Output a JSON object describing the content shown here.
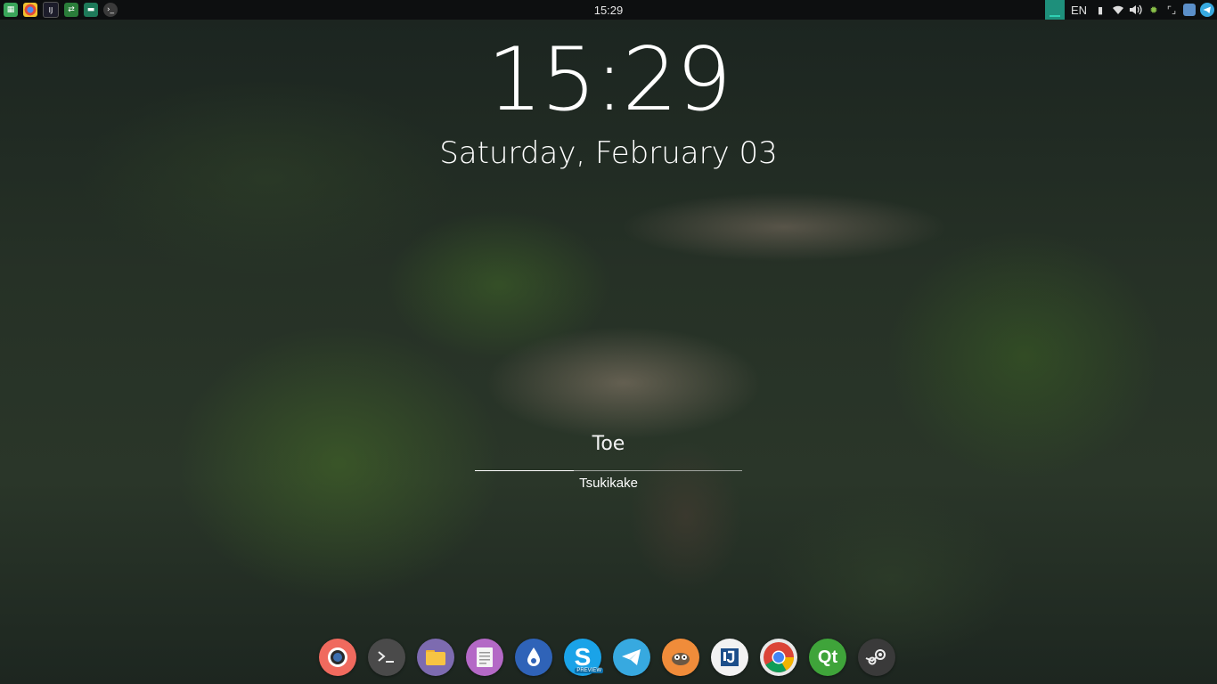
{
  "topbar": {
    "launchers": [
      {
        "icon": "calculator-icon",
        "color": "#3aa55a"
      },
      {
        "icon": "chrome-icon",
        "color": "#444"
      },
      {
        "icon": "jetbrains-icon",
        "color": "#1c1c2a"
      },
      {
        "icon": "network-icon",
        "color": "#2a7d3a"
      },
      {
        "icon": "files-icon",
        "color": "#1e7a5a"
      },
      {
        "icon": "terminal-icon",
        "color": "#3a3a3a"
      }
    ],
    "clock": "15:29",
    "language": "EN",
    "tray": [
      "clipboard-icon",
      "wifi-icon",
      "volume-icon",
      "update-icon",
      "screenshot-icon",
      "notes-icon",
      "telegram-icon"
    ]
  },
  "lockscreen": {
    "time": "15:29",
    "date": "Saturday, February 03",
    "user": "Toe",
    "host": "Tsukikake",
    "password_progress": 0.37
  },
  "dock": {
    "apps": [
      {
        "name": "screenshot-app-icon",
        "color": "#f06a5e"
      },
      {
        "name": "terminal-app-icon",
        "color": "#4a4a4a"
      },
      {
        "name": "files-app-icon",
        "color": "#7d6bb0"
      },
      {
        "name": "text-editor-app-icon",
        "color": "#b469c6"
      },
      {
        "name": "drop-app-icon",
        "color": "#2f63b8"
      },
      {
        "name": "skype-preview-app-icon",
        "color": "#1aa3e8",
        "label": "PREVIEW"
      },
      {
        "name": "telegram-app-icon",
        "color": "#37a9e0"
      },
      {
        "name": "gimp-app-icon",
        "color": "#f08c3a"
      },
      {
        "name": "jetbrains-app-icon",
        "color": "#f2f2f2"
      },
      {
        "name": "chrome-app-icon",
        "color": "#e8e8e8"
      },
      {
        "name": "qt-app-icon",
        "color": "#3fa43a",
        "label": "Qt"
      },
      {
        "name": "steam-app-icon",
        "color": "#3a3a3a"
      }
    ]
  }
}
